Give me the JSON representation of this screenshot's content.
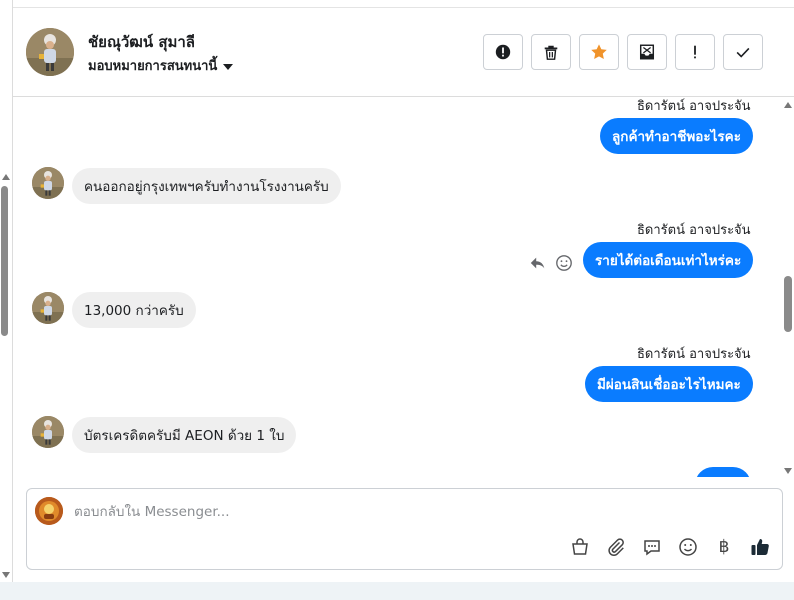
{
  "contact": {
    "name": "ชัยณุวัฒน์ สุมาลี",
    "assign_label": "มอบหมายการสนทนานี้"
  },
  "toolbar": {
    "buttons": [
      {
        "icon": "alert-circle-icon",
        "name": "report-button"
      },
      {
        "icon": "trash-icon",
        "name": "delete-button"
      },
      {
        "icon": "star-icon",
        "name": "star-button"
      },
      {
        "icon": "move-to-inbox-icon",
        "name": "move-button"
      },
      {
        "icon": "exclamation-icon",
        "name": "mark-important-button"
      },
      {
        "icon": "check-icon",
        "name": "mark-done-button"
      }
    ]
  },
  "thread": {
    "messages": [
      {
        "side": "out",
        "sender": "ธิดารัตน์ อาจประจัน",
        "text": "ลูกค้าทำอาชีพอะไรคะ"
      },
      {
        "side": "in",
        "text": "คนออกอยู่กรุงเทพฯครับทำงานโรงงานครับ"
      },
      {
        "side": "out",
        "sender": "ธิดารัตน์ อาจประจัน",
        "text": "รายได้ต่อเดือนเท่าไหร่คะ"
      },
      {
        "side": "in",
        "text": "13,000 กว่าครับ"
      },
      {
        "side": "out",
        "sender": "ธิดารัตน์ อาจประจัน",
        "text": "มีผ่อนสินเชื่ออะไรไหมคะ"
      },
      {
        "side": "in",
        "text": "บัตรเครดิตครับมี AEON ด้วย 1 ใบ"
      }
    ]
  },
  "composer": {
    "placeholder": "ตอบกลับใน Messenger...",
    "tools": [
      "shop-bag-icon",
      "paperclip-icon",
      "saved-reply-icon",
      "emoji-icon",
      "baht-icon",
      "thumbs-up-icon"
    ],
    "baht_symbol": "฿"
  },
  "colors": {
    "accent": "#0a7cff",
    "incoming_bubble": "#efefef",
    "star": "#f0932b"
  }
}
